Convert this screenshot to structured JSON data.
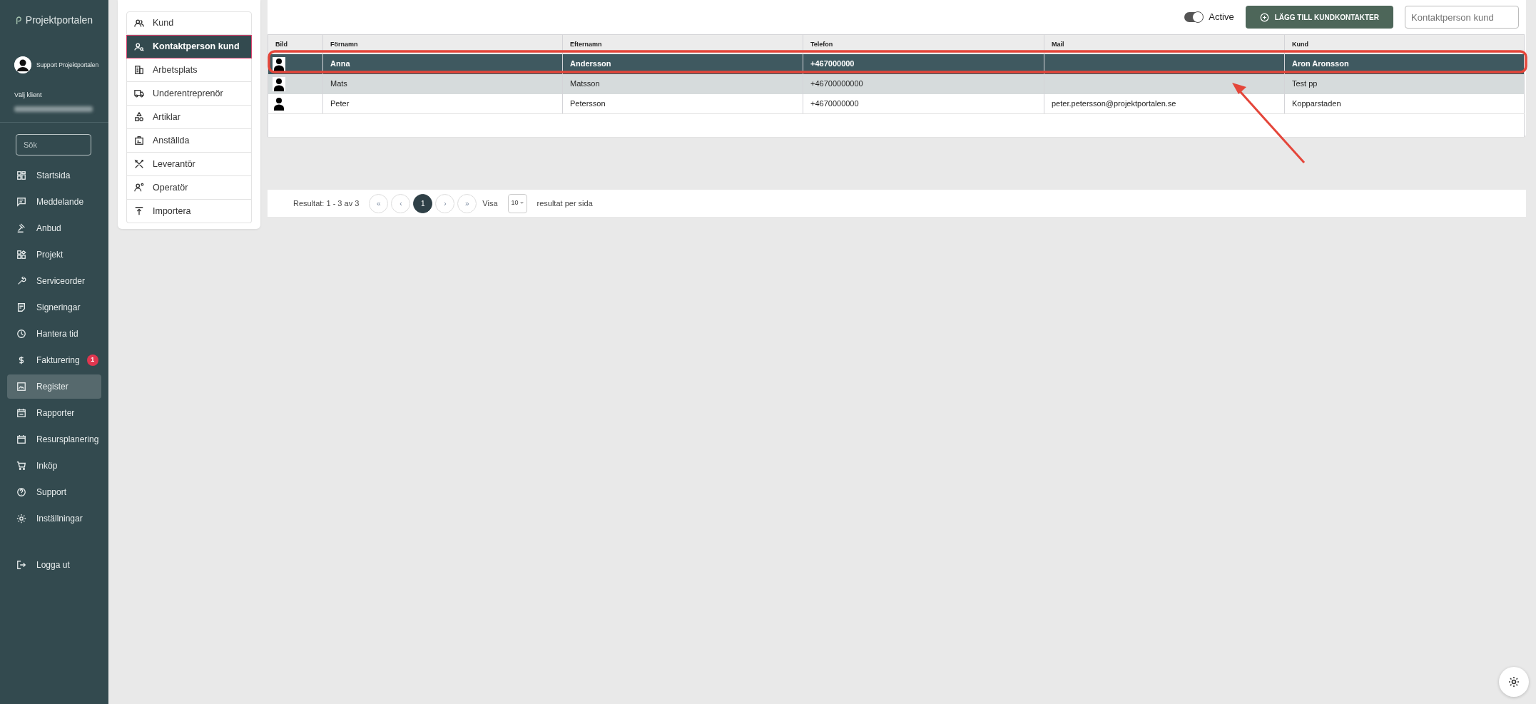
{
  "sidebar": {
    "brand": "Projektportalen",
    "user": "Support Projektportalen",
    "client_label": "Välj klient",
    "search": {
      "placeholder": "Sök"
    },
    "items": [
      {
        "label": "Startsida",
        "selected": false
      },
      {
        "label": "Meddelande",
        "selected": false
      },
      {
        "label": "Anbud",
        "selected": false
      },
      {
        "label": "Projekt",
        "selected": false
      },
      {
        "label": "Serviceorder",
        "selected": false
      },
      {
        "label": "Signeringar",
        "selected": false
      },
      {
        "label": "Hantera tid",
        "selected": false
      },
      {
        "label": "Fakturering",
        "selected": false,
        "badge": "1"
      },
      {
        "label": "Register",
        "selected": true
      },
      {
        "label": "Rapporter",
        "selected": false
      },
      {
        "label": "Resursplanering",
        "selected": false
      },
      {
        "label": "Inköp",
        "selected": false
      },
      {
        "label": "Support",
        "selected": false
      },
      {
        "label": "Inställningar",
        "selected": false
      }
    ],
    "logout": "Logga ut"
  },
  "submenu": [
    {
      "label": "Kund",
      "selected": false
    },
    {
      "label": "Kontaktperson kund",
      "selected": true
    },
    {
      "label": "Arbetsplats",
      "selected": false
    },
    {
      "label": "Underentreprenör",
      "selected": false
    },
    {
      "label": "Artiklar",
      "selected": false
    },
    {
      "label": "Anställda",
      "selected": false
    },
    {
      "label": "Leverantör",
      "selected": false
    },
    {
      "label": "Operatör",
      "selected": false
    },
    {
      "label": "Importera",
      "selected": false
    }
  ],
  "toolbar": {
    "active_toggle": {
      "label": "Active",
      "on": true
    },
    "add_button": "LÄGG TILL KUNDKONTAKTER",
    "search": {
      "placeholder": "Kontaktperson kund"
    }
  },
  "table": {
    "columns": [
      "Bild",
      "Förnamn",
      "Efternamn",
      "Telefon",
      "Mail",
      "Kund"
    ],
    "rows": [
      {
        "selected": true,
        "hovered": false,
        "cells": [
          "",
          "Anna",
          "Andersson",
          "+467000000",
          "",
          "Aron Aronsson"
        ]
      },
      {
        "selected": false,
        "hovered": true,
        "cells": [
          "",
          "Mats",
          "Matsson",
          "+46700000000",
          "",
          "Test pp"
        ]
      },
      {
        "selected": false,
        "hovered": false,
        "cells": [
          "",
          "Peter",
          "Petersson",
          "+4670000000",
          "peter.petersson@projektportalen.se",
          "Kopparstaden"
        ]
      }
    ]
  },
  "pagination": {
    "summary": "Resultat: 1 - 3 av 3",
    "first": "«",
    "prev": "‹",
    "pages": [
      {
        "label": "1",
        "selected": true
      }
    ],
    "next": "›",
    "last": "»",
    "show_label": "Visa",
    "page_size": "10",
    "per_page_label": "resultat per sida"
  }
}
